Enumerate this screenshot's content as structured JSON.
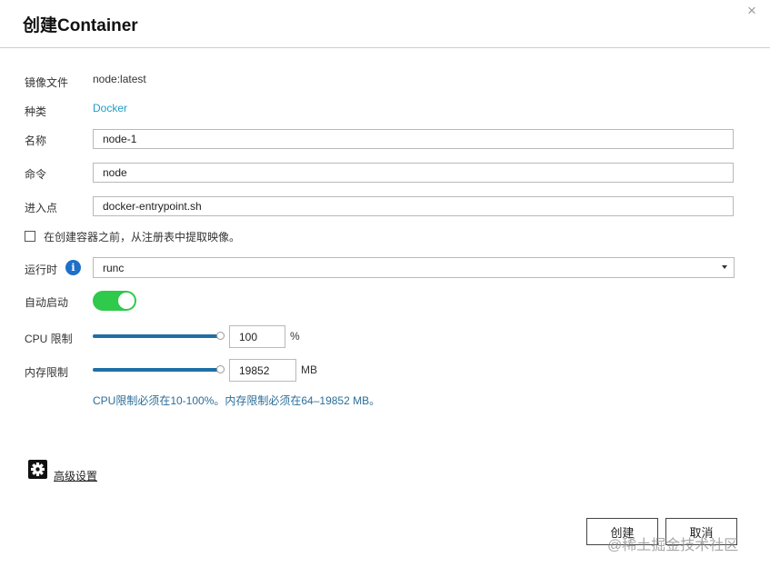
{
  "dialog": {
    "title": "创建Container",
    "close_glyph": "×"
  },
  "form": {
    "image": {
      "label": "镜像文件",
      "value": "node:latest"
    },
    "type": {
      "label": "种类",
      "value": "Docker"
    },
    "name": {
      "label": "名称",
      "value": "node-1"
    },
    "command": {
      "label": "命令",
      "value": "node"
    },
    "entrypoint": {
      "label": "进入点",
      "value": "docker-entrypoint.sh"
    },
    "pull_checkbox": {
      "label": "在创建容器之前，从注册表中提取映像。",
      "checked": false
    },
    "runtime": {
      "label": "运行时",
      "info_glyph": "i",
      "value": "runc"
    },
    "autostart": {
      "label": "自动启动",
      "enabled": true
    },
    "cpu_limit": {
      "label": "CPU 限制",
      "value": "100",
      "unit": "%",
      "fill_fraction": 1.0
    },
    "memory_limit": {
      "label": "内存限制",
      "value": "19852",
      "unit": "MB",
      "fill_fraction": 1.0
    },
    "hint": "CPU限制必须在10-100%。内存限制必须在64–19852 MB。"
  },
  "advanced": {
    "label": "高级设置",
    "icon": "gear-icon"
  },
  "buttons": {
    "create": "创建",
    "cancel": "取消"
  },
  "watermark": "@稀土掘金技术社区",
  "colors": {
    "link": "#1f9ec6",
    "toggle_on": "#2fc94b",
    "slider_fill": "#1f6fa5",
    "info_icon": "#1f6fc8",
    "hint_text": "#2b6e99"
  }
}
